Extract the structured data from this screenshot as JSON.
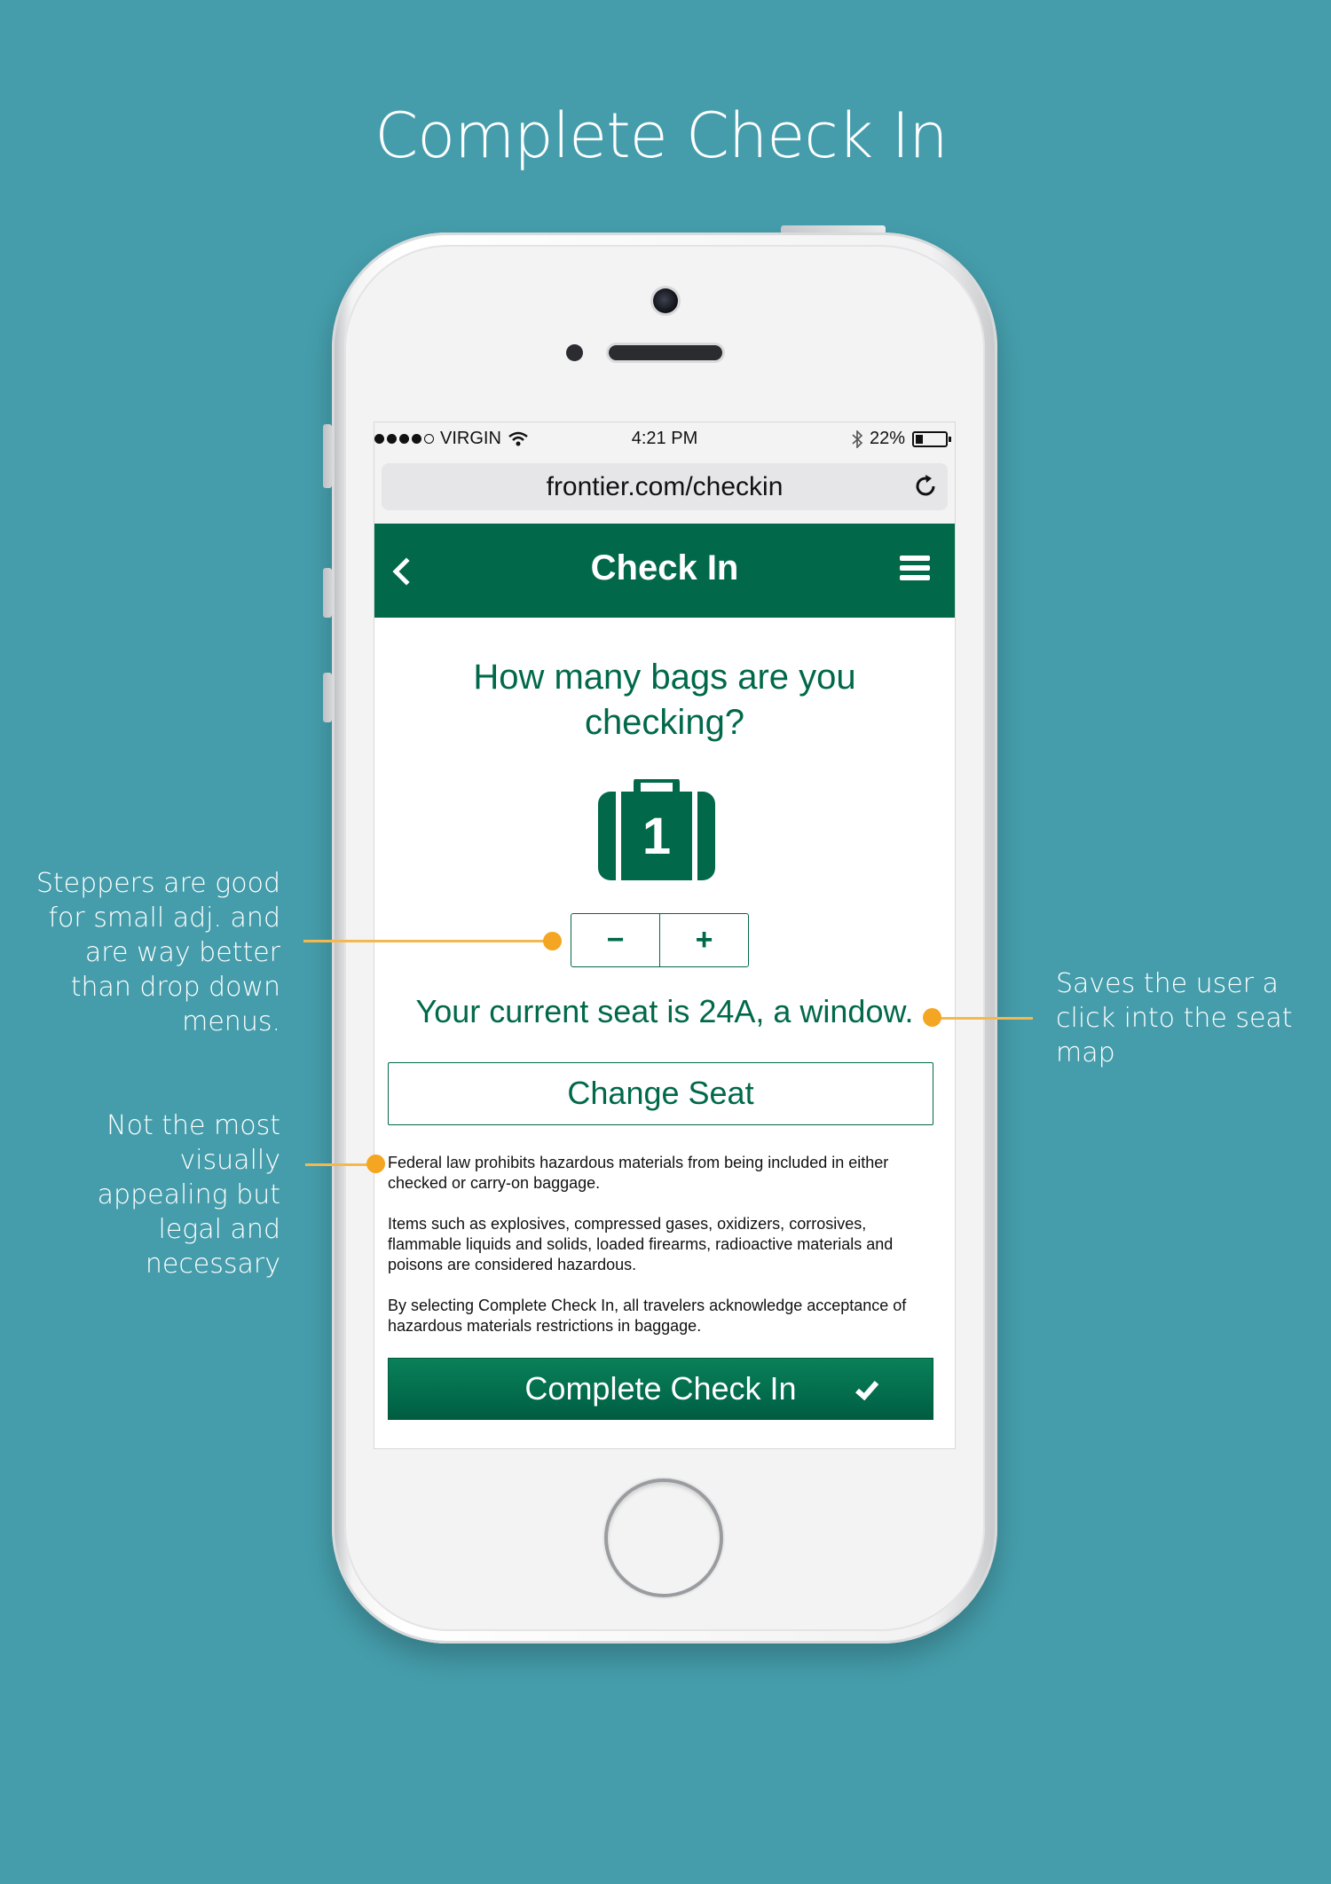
{
  "page_title": "Complete Check In",
  "status_bar": {
    "carrier": "VIRGIN",
    "time": "4:21 PM",
    "battery": "22%"
  },
  "browser": {
    "url": "frontier.com/checkin"
  },
  "header": {
    "title": "Check In"
  },
  "main": {
    "question": "How many bags are you checking?",
    "bag_count": "1",
    "stepper": {
      "minus": "−",
      "plus": "+"
    },
    "seat_text": "Your current seat is 24A, a window.",
    "change_seat_label": "Change Seat",
    "legal": [
      "Federal law prohibits hazardous materials from being included in either checked or carry-on baggage.",
      "Items such as explosives, compressed gases, oxidizers, corrosives, flammable liquids and solids, loaded firearms, radioactive materials and poisons are considered hazardous.",
      "By selecting Complete Check In, all travelers acknowledge acceptance of hazardous materials restrictions in baggage."
    ],
    "complete_button_label": "Complete Check In"
  },
  "annotations": {
    "stepper_note": "Steppers are good for small adj. and are way better than drop down menus.",
    "legal_note": "Not the most visually appealing but legal and necessary",
    "seat_note": "Saves the user a click into the seat map"
  },
  "colors": {
    "background": "#459dab",
    "brand_green": "#01694a",
    "annotation_accent": "#f4a622"
  },
  "icons": [
    "back-chevron-icon",
    "hamburger-menu-icon",
    "reload-icon",
    "wifi-icon",
    "bluetooth-icon",
    "battery-icon",
    "suitcase-icon",
    "checkmark-icon"
  ]
}
